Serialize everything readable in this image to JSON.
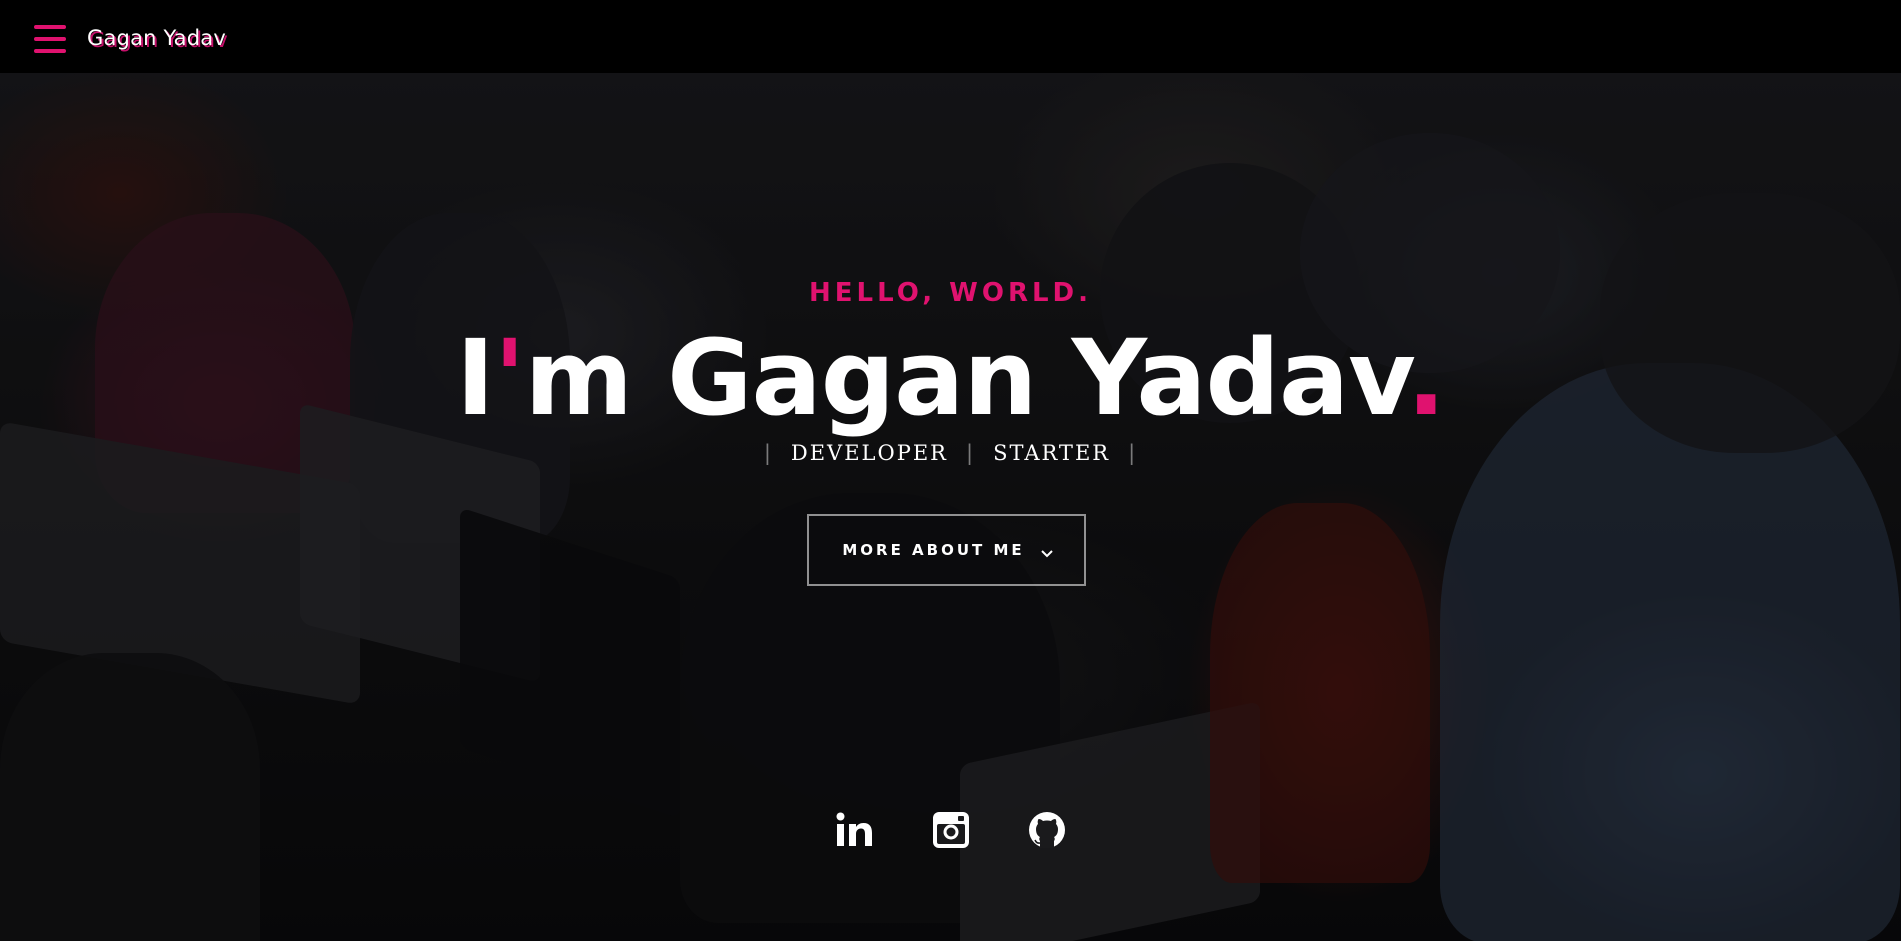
{
  "header": {
    "brand": "Gagan Yadav",
    "menu_icon": "hamburger-menu-icon",
    "accent_color": "#e0126f"
  },
  "hero": {
    "kicker": "HELLO, WORLD.",
    "headline": {
      "prefix": "I",
      "apostrophe": "'",
      "name": "m Gagan Yadav",
      "period": "."
    },
    "roles": [
      "DEVELOPER",
      "STARTER"
    ],
    "separator": "|",
    "cta_label": "MORE ABOUT ME",
    "cta_icon": "chevron-down-icon"
  },
  "socials": [
    {
      "icon": "linkedin-icon",
      "name": "LinkedIn"
    },
    {
      "icon": "instagram-icon",
      "name": "Instagram"
    },
    {
      "icon": "github-icon",
      "name": "GitHub"
    }
  ]
}
